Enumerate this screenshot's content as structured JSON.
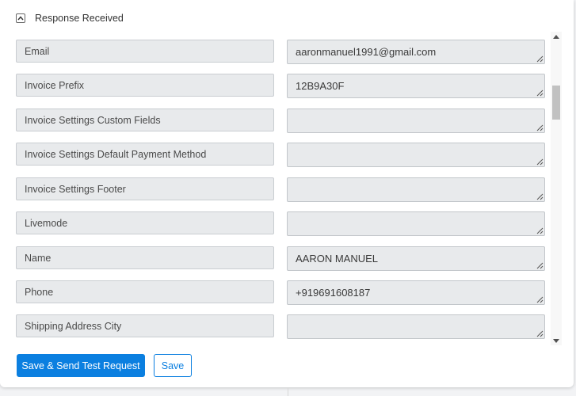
{
  "section": {
    "title": "Response Received",
    "collapse_icon": "chevron-up-icon"
  },
  "fields": [
    {
      "label": "Email",
      "value": "aaronmanuel1991@gmail.com"
    },
    {
      "label": "Invoice Prefix",
      "value": "12B9A30F"
    },
    {
      "label": "Invoice Settings Custom Fields",
      "value": ""
    },
    {
      "label": "Invoice Settings Default Payment Method",
      "value": ""
    },
    {
      "label": "Invoice Settings Footer",
      "value": ""
    },
    {
      "label": "Livemode",
      "value": ""
    },
    {
      "label": "Name",
      "value": "AARON MANUEL"
    },
    {
      "label": "Phone",
      "value": "+919691608187"
    },
    {
      "label": "Shipping Address City",
      "value": ""
    }
  ],
  "actions": {
    "primary_label": "Save & Send Test Request",
    "secondary_label": "Save"
  },
  "colors": {
    "accent": "#0b7fe0",
    "field_background": "#e8eaec",
    "field_border": "#c9cdd1"
  }
}
